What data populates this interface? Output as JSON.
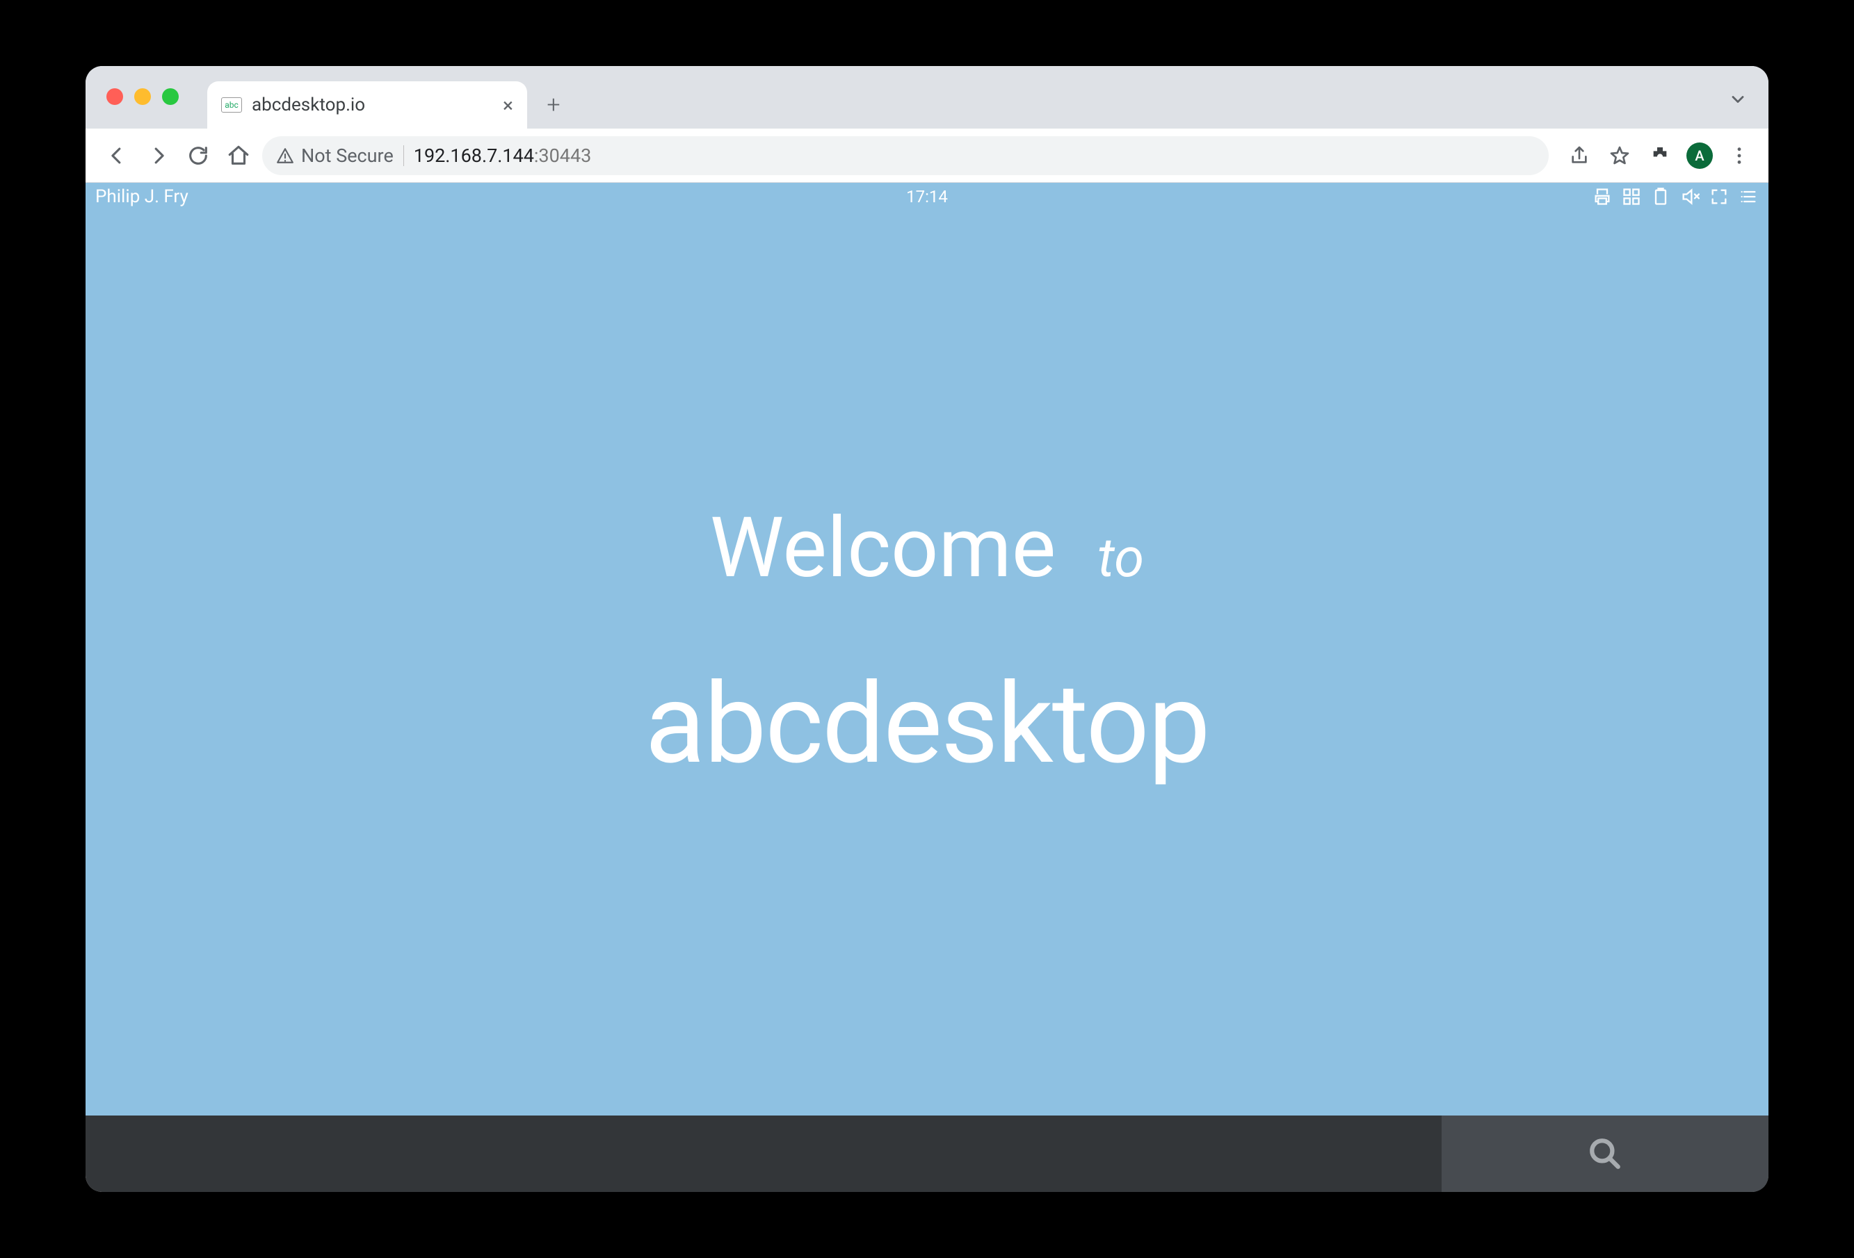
{
  "browser": {
    "tab_title": "abcdesktop.io",
    "favicon_text": "abc",
    "not_secure_label": "Not Secure",
    "url_host": "192.168.7.144",
    "url_port": ":30443",
    "avatar_initial": "A"
  },
  "desktop": {
    "username": "Philip J. Fry",
    "clock": "17:14",
    "welcome_word": "Welcome",
    "welcome_to": "to",
    "welcome_app": "abcdesktop"
  },
  "colors": {
    "desk_bg": "#8ec1e2",
    "dock_bg": "#333639",
    "search_bg": "#474b50"
  }
}
